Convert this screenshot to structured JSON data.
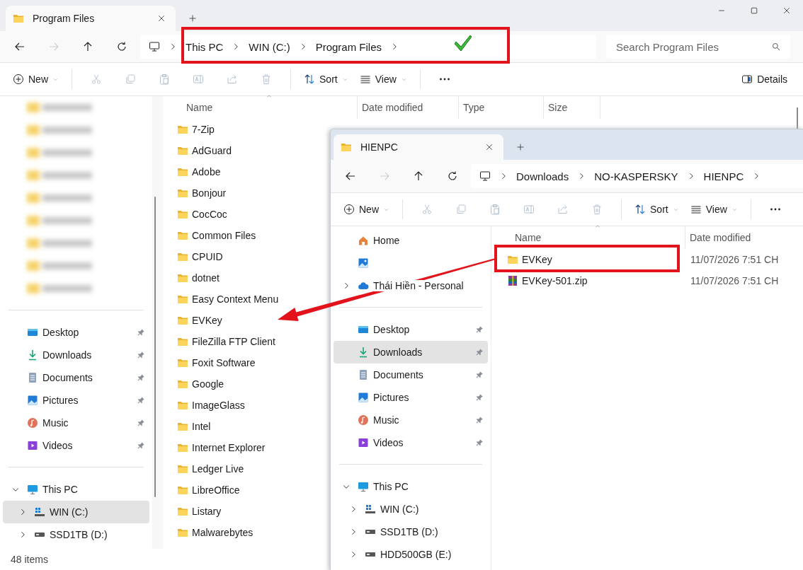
{
  "windows": [
    {
      "kind": "main",
      "tab": {
        "title": "Program Files",
        "selected": true
      },
      "window_controls": [
        {
          "kind": "minimize"
        },
        {
          "kind": "maximize"
        },
        {
          "kind": "close"
        }
      ],
      "nav": [
        {
          "kind": "back",
          "disabled": false
        },
        {
          "kind": "forward",
          "disabled": true
        },
        {
          "kind": "up",
          "disabled": false
        },
        {
          "kind": "refresh",
          "disabled": false
        }
      ],
      "address": {
        "segments": [
          "This PC",
          "WIN (C:)",
          "Program Files"
        ]
      },
      "search": {
        "placeholder": "Search Program Files"
      },
      "toolbar": [
        {
          "kind": "new",
          "label": "New",
          "menu": true,
          "disabled": false
        },
        {
          "kind": "separator"
        },
        {
          "kind": "cut",
          "disabled": true
        },
        {
          "kind": "copy",
          "disabled": true
        },
        {
          "kind": "paste",
          "disabled": true
        },
        {
          "kind": "rename",
          "disabled": true
        },
        {
          "kind": "share",
          "disabled": true
        },
        {
          "kind": "delete",
          "disabled": true
        },
        {
          "kind": "separator"
        },
        {
          "kind": "sort",
          "label": "Sort",
          "menu": true,
          "disabled": false
        },
        {
          "kind": "view",
          "label": "View",
          "menu": true,
          "disabled": false
        },
        {
          "kind": "separator"
        },
        {
          "kind": "more",
          "disabled": false
        }
      ],
      "toolbar_right": {
        "kind": "details",
        "label": "Details"
      },
      "sidebar": {
        "sections": [
          {
            "items": [
              {
                "kind": "blurred",
                "selected": false
              },
              {
                "kind": "blurred",
                "selected": false
              },
              {
                "kind": "blurred",
                "selected": false
              },
              {
                "kind": "blurred",
                "selected": false
              },
              {
                "kind": "blurred",
                "selected": false
              },
              {
                "kind": "blurred",
                "selected": false
              },
              {
                "kind": "blurred",
                "selected": false
              },
              {
                "kind": "blurred",
                "selected": false
              },
              {
                "kind": "blurred",
                "selected": false
              }
            ]
          },
          {
            "items": [
              {
                "kind": "desktop",
                "label": "Desktop",
                "pinned": true,
                "selected": false
              },
              {
                "kind": "downloads",
                "label": "Downloads",
                "pinned": true,
                "selected": false
              },
              {
                "kind": "documents",
                "label": "Documents",
                "pinned": true,
                "selected": false
              },
              {
                "kind": "pictures",
                "label": "Pictures",
                "pinned": true,
                "selected": false
              },
              {
                "kind": "music",
                "label": "Music",
                "pinned": true,
                "selected": false
              },
              {
                "kind": "videos",
                "label": "Videos",
                "pinned": true,
                "selected": false
              }
            ]
          },
          {
            "items": [
              {
                "kind": "pc",
                "label": "This PC",
                "expanded": true,
                "selected": false,
                "children": [
                  {
                    "kind": "system-drive",
                    "label": "WIN (C:)",
                    "expanded": false,
                    "selected": true
                  },
                  {
                    "kind": "drive",
                    "label": "SSD1TB (D:)",
                    "expanded": false,
                    "selected": false
                  }
                ]
              }
            ]
          }
        ]
      },
      "columns": [
        {
          "label": "Name",
          "sorted": true
        },
        {
          "label": "Date modified",
          "sorted": false
        },
        {
          "label": "Type",
          "sorted": false
        },
        {
          "label": "Size",
          "sorted": false
        }
      ],
      "files": [
        {
          "kind": "folder",
          "name": "7-Zip"
        },
        {
          "kind": "folder",
          "name": "AdGuard"
        },
        {
          "kind": "folder",
          "name": "Adobe"
        },
        {
          "kind": "folder",
          "name": "Bonjour"
        },
        {
          "kind": "folder",
          "name": "CocCoc"
        },
        {
          "kind": "folder",
          "name": "Common Files"
        },
        {
          "kind": "folder",
          "name": "CPUID"
        },
        {
          "kind": "folder",
          "name": "dotnet"
        },
        {
          "kind": "folder",
          "name": "Easy Context Menu"
        },
        {
          "kind": "folder",
          "name": "EVKey"
        },
        {
          "kind": "folder",
          "name": "FileZilla FTP Client"
        },
        {
          "kind": "folder",
          "name": "Foxit Software"
        },
        {
          "kind": "folder",
          "name": "Google"
        },
        {
          "kind": "folder",
          "name": "ImageGlass"
        },
        {
          "kind": "folder",
          "name": "Intel"
        },
        {
          "kind": "folder",
          "name": "Internet Explorer"
        },
        {
          "kind": "folder",
          "name": "Ledger Live"
        },
        {
          "kind": "folder",
          "name": "LibreOffice"
        },
        {
          "kind": "folder",
          "name": "Listary"
        },
        {
          "kind": "folder",
          "name": "Malwarebytes"
        }
      ],
      "status_bar": "48 items"
    },
    {
      "kind": "floating",
      "tab": {
        "title": "HIENPC",
        "selected": true
      },
      "nav": [
        {
          "kind": "back",
          "disabled": false
        },
        {
          "kind": "forward",
          "disabled": true
        },
        {
          "kind": "up",
          "disabled": false
        },
        {
          "kind": "refresh",
          "disabled": false
        }
      ],
      "address": {
        "segments": [
          "Downloads",
          "NO-KASPERSKY",
          "HIENPC"
        ]
      },
      "toolbar": [
        {
          "kind": "new",
          "label": "New",
          "menu": true,
          "disabled": false
        },
        {
          "kind": "separator"
        },
        {
          "kind": "cut",
          "disabled": true
        },
        {
          "kind": "copy",
          "disabled": true
        },
        {
          "kind": "paste",
          "disabled": true
        },
        {
          "kind": "rename",
          "disabled": true
        },
        {
          "kind": "share",
          "disabled": true
        },
        {
          "kind": "delete",
          "disabled": true
        },
        {
          "kind": "separator"
        },
        {
          "kind": "sort",
          "label": "Sort",
          "menu": true,
          "disabled": false
        },
        {
          "kind": "view",
          "label": "View",
          "menu": true,
          "disabled": false
        },
        {
          "kind": "separator"
        },
        {
          "kind": "more",
          "disabled": false
        }
      ],
      "sidebar": {
        "sections": [
          {
            "items": [
              {
                "kind": "home",
                "label": "Home",
                "selected": false
              },
              {
                "kind": "gallery",
                "selected": false
              },
              {
                "kind": "cloud",
                "label": "Thái Hiền - Personal",
                "expanded": false,
                "selected": false
              }
            ]
          },
          {
            "items": [
              {
                "kind": "desktop",
                "label": "Desktop",
                "pinned": true,
                "selected": false
              },
              {
                "kind": "downloads",
                "label": "Downloads",
                "pinned": true,
                "selected": true
              },
              {
                "kind": "documents",
                "label": "Documents",
                "pinned": true,
                "selected": false
              },
              {
                "kind": "pictures",
                "label": "Pictures",
                "pinned": true,
                "selected": false
              },
              {
                "kind": "music",
                "label": "Music",
                "pinned": true,
                "selected": false
              },
              {
                "kind": "videos",
                "label": "Videos",
                "pinned": true,
                "selected": false
              }
            ]
          },
          {
            "items": [
              {
                "kind": "pc",
                "label": "This PC",
                "expanded": true,
                "selected": false,
                "children": [
                  {
                    "kind": "system-drive",
                    "label": "WIN (C:)",
                    "expanded": false,
                    "selected": false
                  },
                  {
                    "kind": "drive",
                    "label": "SSD1TB (D:)",
                    "expanded": false,
                    "selected": false
                  },
                  {
                    "kind": "drive",
                    "label": "HDD500GB (E:)",
                    "expanded": false,
                    "selected": false
                  }
                ]
              }
            ]
          }
        ]
      },
      "columns": [
        {
          "label": "Name",
          "sorted": true
        },
        {
          "label": "Date modified",
          "sorted": false
        }
      ],
      "files": [
        {
          "kind": "folder",
          "name": "EVKey",
          "date": "11/07/2026 7:51 CH"
        },
        {
          "kind": "archive",
          "name": "EVKey-501.zip",
          "date": "11/07/2026 7:51 CH"
        }
      ]
    }
  ],
  "annotations": [
    {
      "kind": "frame"
    },
    {
      "kind": "frame"
    },
    {
      "kind": "arrow"
    },
    {
      "kind": "checkmark"
    }
  ]
}
